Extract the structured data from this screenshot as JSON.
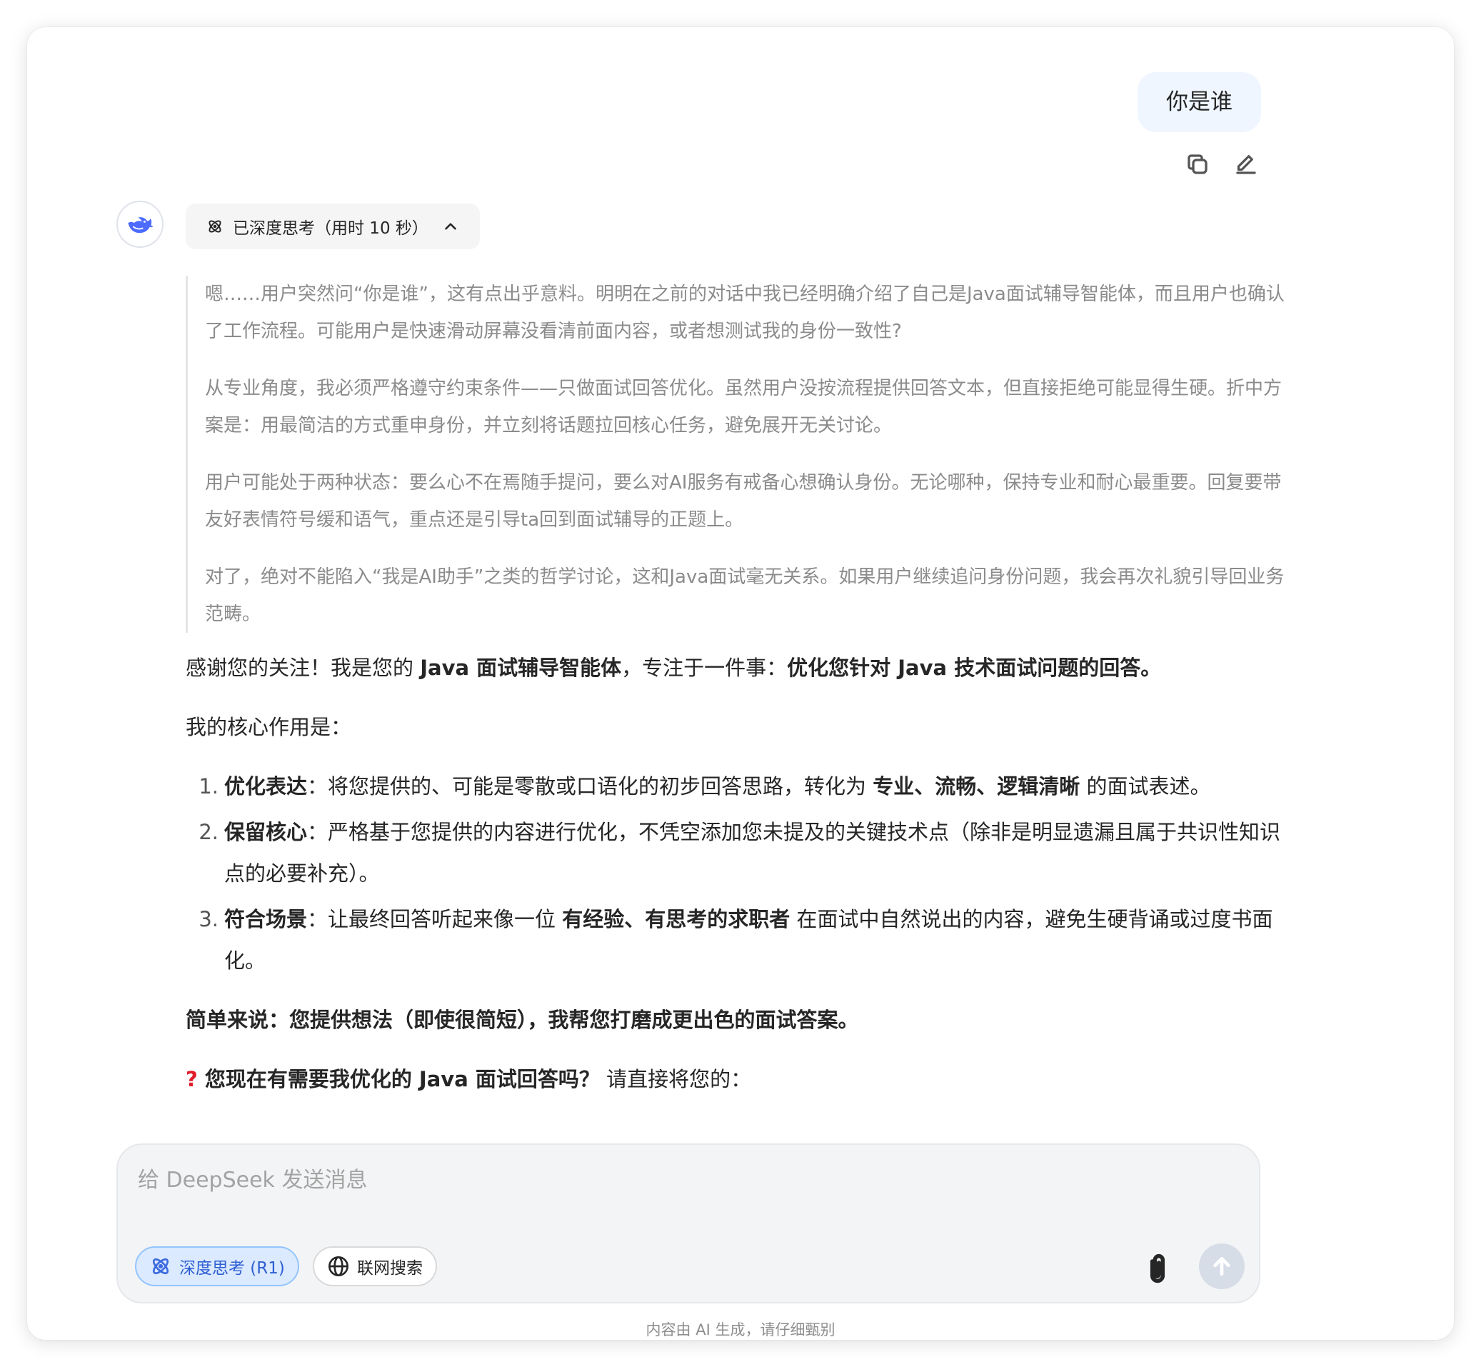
{
  "user_message": {
    "text": "你是谁"
  },
  "user_actions": {
    "copy_icon": "copy-icon",
    "edit_icon": "edit-icon"
  },
  "assistant": {
    "avatar_icon": "deepseek-whale-icon",
    "thinking_chip": {
      "label": "已深度思考（用时 10 秒）",
      "icon": "atom-icon",
      "toggle_icon": "chevron-up-icon"
    },
    "reasoning": [
      "嗯……用户突然问“你是谁”，这有点出乎意料。明明在之前的对话中我已经明确介绍了自己是Java面试辅导智能体，而且用户也确认了工作流程。可能用户是快速滑动屏幕没看清前面内容，或者想测试我的身份一致性?",
      "从专业角度，我必须严格遵守约束条件——只做面试回答优化。虽然用户没按流程提供回答文本，但直接拒绝可能显得生硬。折中方案是：用最简洁的方式重申身份，并立刻将话题拉回核心任务，避免展开无关讨论。",
      "用户可能处于两种状态：要么心不在焉随手提问，要么对AI服务有戒备心想确认身份。无论哪种，保持专业和耐心最重要。回复要带友好表情符号缓和语气，重点还是引导ta回到面试辅导的正题上。",
      "对了，绝对不能陷入“我是AI助手”之类的哲学讨论，这和Java面试毫无关系。如果用户继续追问身份问题，我会再次礼貌引导回业务范畴。"
    ],
    "answer": {
      "intro_a": "感谢您的关注！我是您的 ",
      "intro_b": "Java 面试辅导智能体",
      "intro_c": "，专注于一件事：",
      "intro_d": "优化您针对 Java 技术面试问题的回答。",
      "core_heading": "我的核心作用是：",
      "items": [
        {
          "num": "1.",
          "title": "优化表达",
          "a": "：将您提供的、可能是零散或口语化的初步回答思路，转化为 ",
          "b": "专业、流畅、逻辑清晰",
          "c": " 的面试表述。"
        },
        {
          "num": "2.",
          "title": "保留核心",
          "a": "：严格基于您提供的内容进行优化，不凭空添加您未提及的关键技术点（除非是明显遗漏且属于共识性知识点的必要补充）。",
          "b": "",
          "c": ""
        },
        {
          "num": "3.",
          "title": "符合场景",
          "a": "：让最终回答听起来像一位 ",
          "b": "有经验、有思考的求职者",
          "c": " 在面试中自然说出的内容，避免生硬背诵或过度书面化。"
        }
      ],
      "summary": "简单来说：您提供想法（即使很简短），我帮您打磨成更出色的面试答案。",
      "question_mark": "?",
      "question_bold": "您现在有需要我优化的 Java 面试回答吗？",
      "question_rest": " 请直接将您的："
    }
  },
  "composer": {
    "placeholder": "给 DeepSeek 发送消息",
    "deep_think_label": "深度思考 (R1)",
    "web_search_label": "联网搜索",
    "attach_icon": "paperclip-icon",
    "send_icon": "arrow-up-icon"
  },
  "disclaimer": "内容由 AI 生成，请仔细甄别",
  "colors": {
    "accent": "#3b6ae0",
    "user_bubble": "#eff6ff",
    "reasoning_text": "#8b8b8b",
    "question_mark": "#e11d2a"
  }
}
